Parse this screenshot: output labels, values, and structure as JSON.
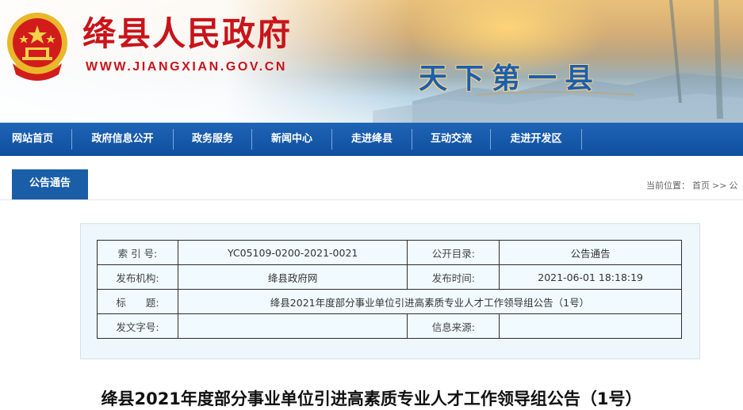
{
  "header": {
    "site_title": "绛县人民政府",
    "site_url": "WWW.JIANGXIAN.GOV.CN",
    "slogan": "天下第一县",
    "emblem_icon": "national-emblem-icon"
  },
  "nav": {
    "items": [
      {
        "label": "网站首页"
      },
      {
        "label": "政府信息公开"
      },
      {
        "label": "政务服务"
      },
      {
        "label": "新闻中心"
      },
      {
        "label": "走进绛县"
      },
      {
        "label": "互动交流"
      },
      {
        "label": "走进开发区"
      }
    ]
  },
  "section": {
    "tab_label": "公告通告",
    "breadcrumb_prefix": "当前位置：",
    "breadcrumb_home": "首页",
    "breadcrumb_sep": ">>",
    "breadcrumb_current": "公"
  },
  "info": {
    "index_label": "索 引 号:",
    "index_value": "YC05109-0200-2021-0021",
    "catalog_label": "公开目录:",
    "catalog_value": "公告通告",
    "publisher_label": "发布机构:",
    "publisher_value": "绛县政府网",
    "date_label": "发布时间:",
    "date_value": "2021-06-01 18:18:19",
    "title_label": "标　　题:",
    "title_value": "绛县2021年度部分事业单位引进高素质专业人才工作领导组公告（1号）",
    "docno_label": "发文字号:",
    "docno_value": "",
    "source_label": "信息来源:",
    "source_value": ""
  },
  "article": {
    "headline": "绛县2021年度部分事业单位引进高素质专业人才工作领导组公告（1号）"
  },
  "colors": {
    "brand_red": "#c8141a",
    "nav_blue": "#1a5ea8",
    "slogan_blue": "#1b5fb0"
  }
}
